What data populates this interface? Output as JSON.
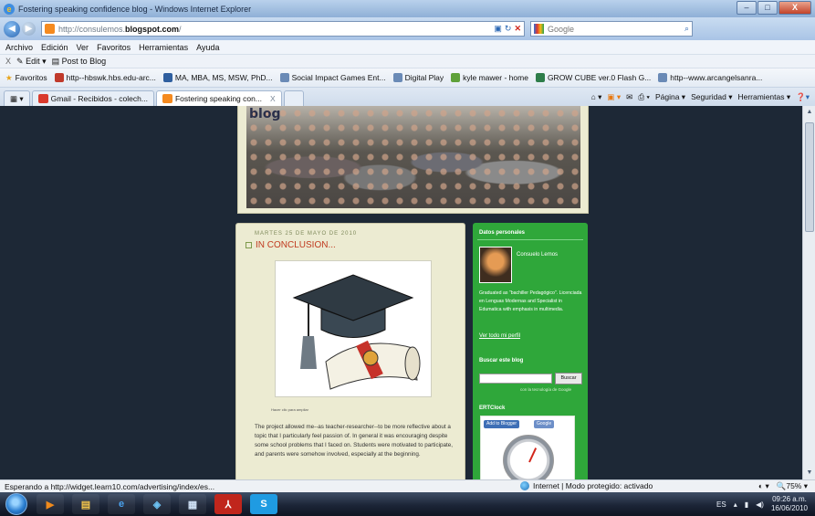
{
  "window": {
    "title": "Fostering speaking confidence blog - Windows Internet Explorer",
    "min": "–",
    "max": "□",
    "close": "X"
  },
  "address": {
    "url_prefix": "http://consulemos.",
    "url_domain": "blogspot.com",
    "url_suffix": "/",
    "search_placeholder": "Google"
  },
  "menu": [
    "Archivo",
    "Edición",
    "Ver",
    "Favoritos",
    "Herramientas",
    "Ayuda"
  ],
  "toolbar": {
    "close": "X",
    "edit": "Edit",
    "post": "Post to Blog"
  },
  "favorites": {
    "label": "Favoritos",
    "items": [
      "http--hbswk.hbs.edu-arc...",
      "MA, MBA, MS, MSW, PhD...",
      "Social Impact Games Ent...",
      "Digital Play",
      "kyle mawer - home",
      "GROW CUBE ver.0 Flash G...",
      "http--www.arcangelsanra..."
    ]
  },
  "tabs": [
    {
      "label": "Gmail - Recibidos - colech..."
    },
    {
      "label": "Fostering speaking con...",
      "close": "X"
    }
  ],
  "commands": {
    "page": "Página",
    "security": "Seguridad",
    "tools": "Herramientas"
  },
  "blog": {
    "header_word": "blog",
    "post": {
      "date": "MARTES 25 DE MAYO DE 2010",
      "title": "IN CONCLUSION...",
      "image_caption": "Hacer clic para ampliar",
      "body": "The project allowed me--as teacher-researcher--to be more reflective about a topic that I particularly feel passion of. In general it was encouraging despite some school problems that I faced on. Students were motivated to participate, and parents were somehow involved, especially at the beginning."
    },
    "sidebar": {
      "profile_heading": "Datos personales",
      "profile_name": "Consuelo Lemos",
      "profile_desc": "Graduated as \"bachiller Pedagógico\". Licenciada en Lenguas Modernas and Specialist in Edumatica with emphasis in multimedia.",
      "profile_link": "Ver todo mi perfil",
      "search_heading": "Buscar este blog",
      "search_button": "Buscar",
      "powered": "con la tecnología de Google",
      "clock_heading": "ERTClock",
      "widget_add": "Add to Blogger",
      "widget_google": "Google"
    }
  },
  "status": {
    "text": "Esperando a http://widget.learn10.com/advertising/index/es...",
    "zone": "Internet | Modo protegido: activado",
    "zoom": "75%"
  },
  "taskbar": {
    "lang": "ES",
    "time": "09:26 a.m.",
    "date": "16/06/2010"
  },
  "colors": {
    "post_title": "#c03a1f",
    "sidebar_green": "#2fa73a",
    "page_bg": "#1d2836"
  }
}
